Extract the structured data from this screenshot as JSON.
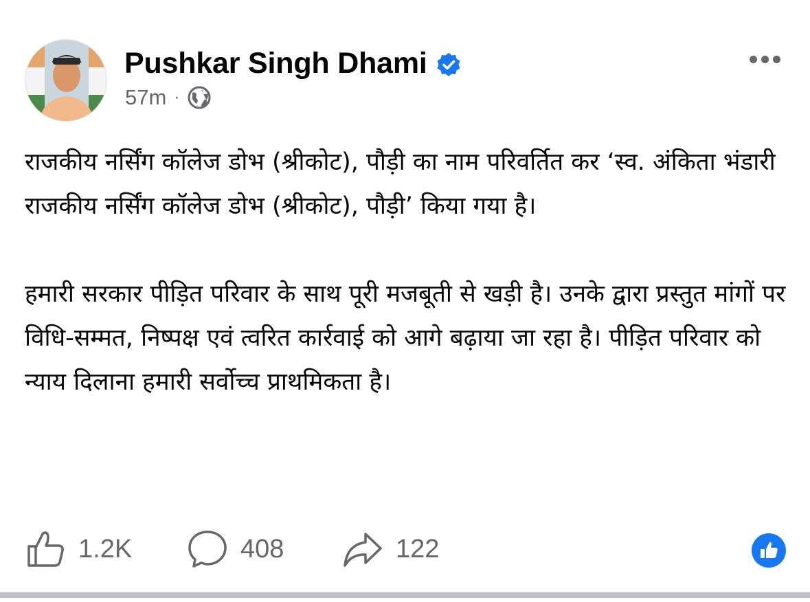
{
  "post": {
    "author": {
      "name": "Pushkar Singh Dhami",
      "verified": true
    },
    "timestamp": "57m",
    "separator": "·",
    "audience_icon": "globe-icon",
    "paragraphs": [
      "राजकीय नर्सिंग कॉलेज डोभ (श्रीकोट), पौड़ी का नाम परिवर्तित कर ‘स्व. अंकिता भंडारी राजकीय नर्सिंग कॉलेज डोभ (श्रीकोट), पौड़ी’ किया गया है।",
      "हमारी सरकार पीड़ित परिवार के साथ पूरी मजबूती से खड़ी है। उनके द्वारा प्रस्तुत मांगों पर विधि-सम्मत, निष्पक्ष एवं त्वरित कार्रवाई को आगे बढ़ाया जा रहा है। पीड़ित परिवार को न्याय दिलाना हमारी सर्वोच्च प्राथमिकता है।"
    ],
    "stats": {
      "likes": "1.2K",
      "comments": "408",
      "shares": "122"
    },
    "colors": {
      "accent": "#1877f2",
      "secondary_text": "#65676b",
      "primary_text": "#050505"
    }
  }
}
